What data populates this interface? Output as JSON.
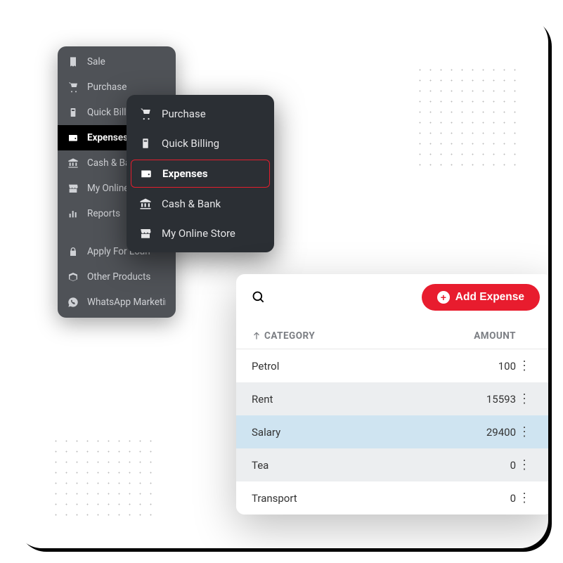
{
  "sidebar1": {
    "items": [
      {
        "icon": "receipt",
        "label": "Sale"
      },
      {
        "icon": "cart",
        "label": "Purchase"
      },
      {
        "icon": "bill",
        "label": "Quick Billing"
      },
      {
        "icon": "wallet",
        "label": "Expenses",
        "active": true
      },
      {
        "icon": "bank",
        "label": "Cash & Bank"
      },
      {
        "icon": "store",
        "label": "My Online Store"
      },
      {
        "icon": "chart",
        "label": "Reports"
      },
      {
        "icon": "lock",
        "label": "Apply For Loan",
        "group": true
      },
      {
        "icon": "box",
        "label": "Other Products"
      },
      {
        "icon": "whatsapp",
        "label": "WhatsApp Marketing"
      }
    ]
  },
  "sidebar2": {
    "items": [
      {
        "icon": "cart",
        "label": "Purchase"
      },
      {
        "icon": "bill",
        "label": "Quick Billing"
      },
      {
        "icon": "wallet",
        "label": "Expenses",
        "active": true
      },
      {
        "icon": "bank",
        "label": "Cash & Bank"
      },
      {
        "icon": "store",
        "label": "My Online Store"
      }
    ]
  },
  "panel": {
    "add_label": "Add Expense",
    "col_category": "CATEGORY",
    "col_amount": "AMOUNT",
    "rows": [
      {
        "category": "Petrol",
        "amount": "100"
      },
      {
        "category": "Rent",
        "amount": "15593"
      },
      {
        "category": "Salary",
        "amount": "29400",
        "highlight": true
      },
      {
        "category": "Tea",
        "amount": "0"
      },
      {
        "category": "Transport",
        "amount": "0"
      }
    ]
  }
}
